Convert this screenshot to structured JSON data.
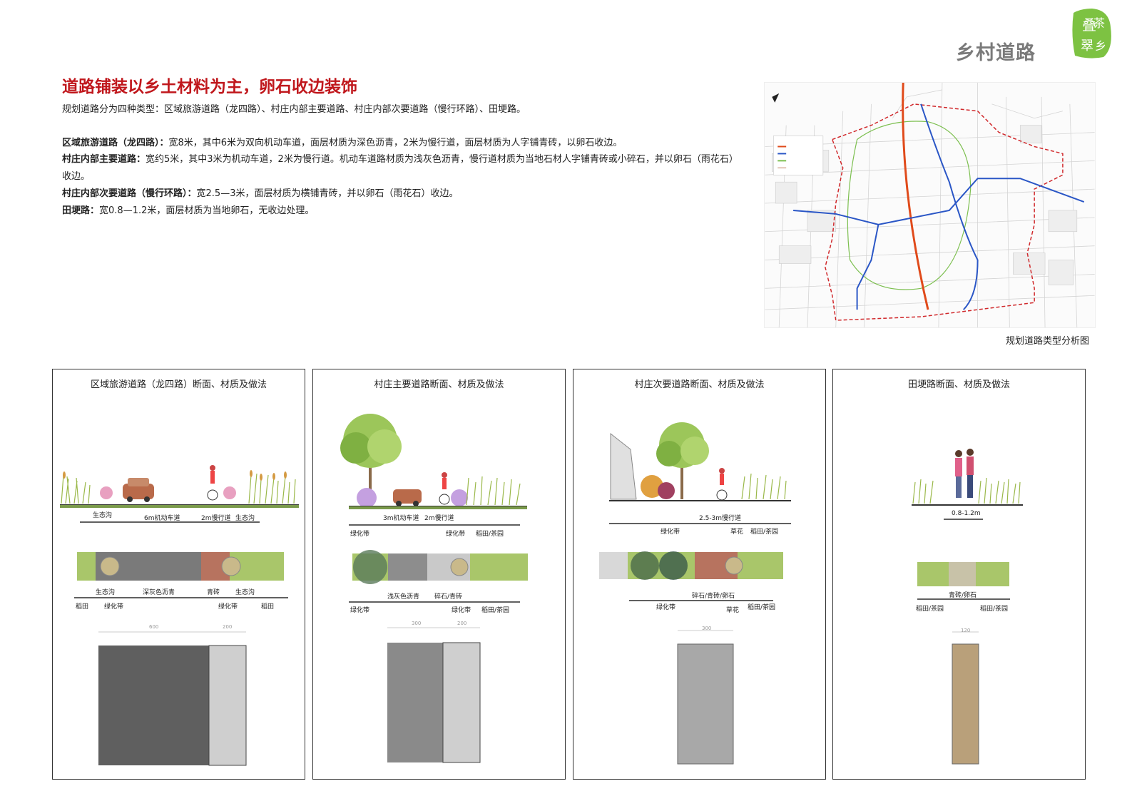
{
  "page_title": "乡村道路",
  "logo_text": "叠翠茶乡",
  "headline": "道路铺装以乡土材料为主，卵石收边装饰",
  "intro": "规划道路分为四种类型：区域旅游道路（龙四路）、村庄内部主要道路、村庄内部次要道路（慢行环路）、田埂路。",
  "paragraphs": [
    {
      "term": "区域旅游道路（龙四路）：",
      "text": "宽8米，其中6米为双向机动车道，面层材质为深色沥青，2米为慢行道，面层材质为人字铺青砖，以卵石收边。"
    },
    {
      "term": "村庄内部主要道路：",
      "text": "宽约5米，其中3米为机动车道，2米为慢行道。机动车道路材质为浅灰色沥青，慢行道材质为当地石材人字铺青砖或小碎石，并以卵石（雨花石）收边。"
    },
    {
      "term": "村庄内部次要道路（慢行环路）：",
      "text": "宽2.5—3米，面层材质为横铺青砖，并以卵石（雨花石）收边。"
    },
    {
      "term": "田埂路：",
      "text": "宽0.8—1.2米，面层材质为当地卵石，无收边处理。"
    }
  ],
  "map_caption": "规划道路类型分析图",
  "panels": [
    {
      "title": "区域旅游道路（龙四路）断面、材质及做法",
      "sec_top": [
        "生态沟",
        "6m机动车道",
        "2m慢行道",
        "生态沟"
      ],
      "plan_top": [
        "生态沟",
        "深灰色沥青",
        "青砖",
        "生态沟"
      ],
      "plan_bot": [
        "稻田",
        "绿化带",
        "绿化带",
        "稻田"
      ],
      "dims": [
        "600",
        "200"
      ]
    },
    {
      "title": "村庄主要道路断面、材质及做法",
      "sec_top": [
        "3m机动车道",
        "2m慢行道"
      ],
      "sec_bot": [
        "绿化带",
        "绿化带",
        "稻田/茶园"
      ],
      "plan_top": [
        "浅灰色沥青",
        "碎石/青砖"
      ],
      "plan_bot": [
        "绿化带",
        "绿化带",
        "稻田/茶园"
      ],
      "dims": [
        "300",
        "200"
      ]
    },
    {
      "title": "村庄次要道路断面、材质及做法",
      "sec_top": [
        "2.5-3m慢行道"
      ],
      "sec_bot": [
        "绿化带",
        "草花",
        "稻田/茶园"
      ],
      "plan_top": [
        "碎石/青砖/卵石"
      ],
      "plan_bot": [
        "绿化带",
        "草花",
        "稻田/茶园"
      ],
      "dims": [
        "300"
      ]
    },
    {
      "title": "田埂路断面、材质及做法",
      "sec_top": [
        "0.8-1.2m"
      ],
      "plan_top": [
        "青砖/卵石"
      ],
      "plan_bot": [
        "稻田/茶园",
        "稻田/茶园"
      ],
      "dims": [
        "120"
      ]
    }
  ],
  "colors": {
    "headline": "#c0171c",
    "asphalt_dark": "#5f5f5f",
    "asphalt_light": "#8d8d8d",
    "green_belt": "#a9c66a",
    "brick": "#b7735f",
    "tourist_road": "#e04a1a",
    "main_road": "#2a56c6",
    "secondary_road": "#7cbf4f",
    "boundary": "#d0282b"
  }
}
